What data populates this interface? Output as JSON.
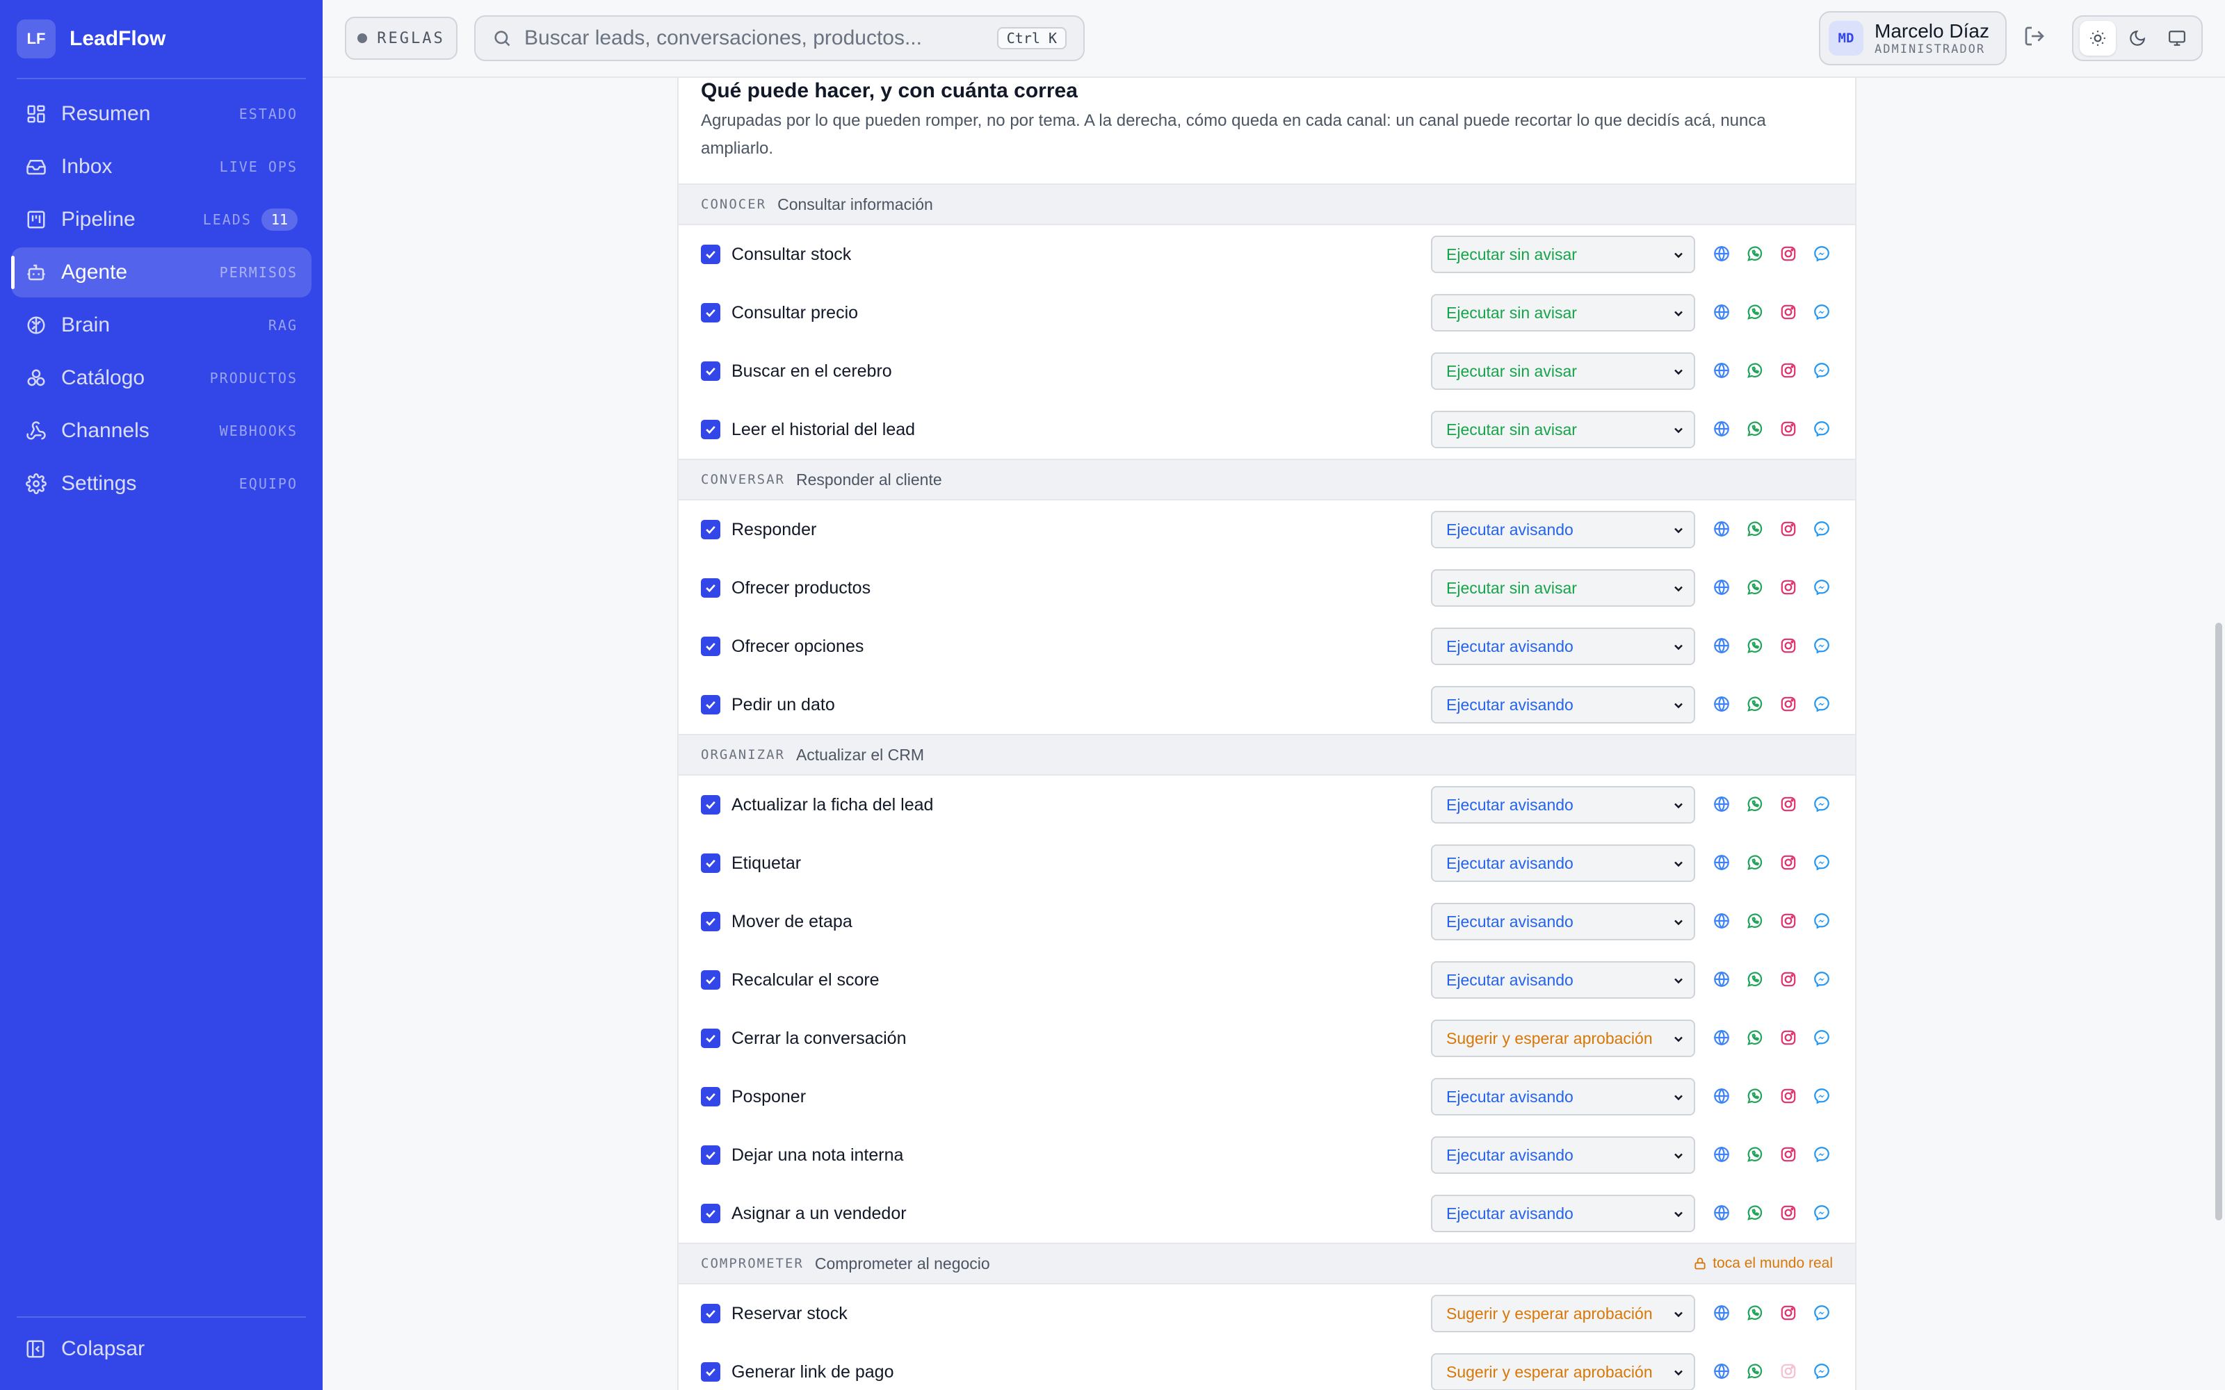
{
  "app": {
    "logo": "LF",
    "name": "LeadFlow"
  },
  "sidebar": {
    "items": [
      {
        "label": "Resumen",
        "tag": "ESTADO",
        "icon": "dashboard-icon"
      },
      {
        "label": "Inbox",
        "tag": "LIVE OPS",
        "icon": "inbox-icon"
      },
      {
        "label": "Pipeline",
        "tag": "LEADS",
        "badge": "11",
        "icon": "kanban-icon"
      },
      {
        "label": "Agente",
        "tag": "PERMISOS",
        "icon": "bot-icon",
        "active": true
      },
      {
        "label": "Brain",
        "tag": "RAG",
        "icon": "brain-icon"
      },
      {
        "label": "Catálogo",
        "tag": "PRODUCTOS",
        "icon": "boxes-icon"
      },
      {
        "label": "Channels",
        "tag": "WEBHOOKS",
        "icon": "webhook-icon"
      },
      {
        "label": "Settings",
        "tag": "EQUIPO",
        "icon": "gear-icon"
      }
    ],
    "collapse_label": "Colapsar"
  },
  "topbar": {
    "rules_chip": "REGLAS",
    "search_placeholder": "Buscar leads, conversaciones, productos...",
    "search_shortcut": "Ctrl K",
    "user": {
      "initials": "MD",
      "name": "Marcelo Díaz",
      "role": "ADMINISTRADOR"
    }
  },
  "card": {
    "title": "Qué puede hacer, y con cuánta correa",
    "description": "Agrupadas por lo que pueden romper, no por tema. A la derecha, cómo queda en cada canal: un canal puede recortar lo que decidís acá, nunca ampliarlo."
  },
  "modes": {
    "silent": "Ejecutar sin avisar",
    "notify": "Ejecutar avisando",
    "approve": "Sugerir y esperar aprobación"
  },
  "sections": [
    {
      "code": "CONOCER",
      "label": "Consultar información",
      "rows": [
        {
          "label": "Consultar stock",
          "mode": "silent"
        },
        {
          "label": "Consultar precio",
          "mode": "silent"
        },
        {
          "label": "Buscar en el cerebro",
          "mode": "silent"
        },
        {
          "label": "Leer el historial del lead",
          "mode": "silent"
        }
      ]
    },
    {
      "code": "CONVERSAR",
      "label": "Responder al cliente",
      "rows": [
        {
          "label": "Responder",
          "mode": "notify"
        },
        {
          "label": "Ofrecer productos",
          "mode": "silent"
        },
        {
          "label": "Ofrecer opciones",
          "mode": "notify"
        },
        {
          "label": "Pedir un dato",
          "mode": "notify"
        }
      ]
    },
    {
      "code": "ORGANIZAR",
      "label": "Actualizar el CRM",
      "rows": [
        {
          "label": "Actualizar la ficha del lead",
          "mode": "notify"
        },
        {
          "label": "Etiquetar",
          "mode": "notify"
        },
        {
          "label": "Mover de etapa",
          "mode": "notify"
        },
        {
          "label": "Recalcular el score",
          "mode": "notify"
        },
        {
          "label": "Cerrar la conversación",
          "mode": "approve"
        },
        {
          "label": "Posponer",
          "mode": "notify"
        },
        {
          "label": "Dejar una nota interna",
          "mode": "notify"
        },
        {
          "label": "Asignar a un vendedor",
          "mode": "notify"
        }
      ]
    },
    {
      "code": "COMPROMETER",
      "label": "Comprometer al negocio",
      "warning": "toca el mundo real",
      "rows": [
        {
          "label": "Reservar stock",
          "mode": "approve"
        },
        {
          "label": "Generar link de pago",
          "mode": "approve",
          "instagram_disabled": true
        }
      ]
    }
  ],
  "colors": {
    "accent": "#3346e8",
    "silent": "#16a34a",
    "notify": "#2563eb",
    "approve": "#d97706"
  }
}
